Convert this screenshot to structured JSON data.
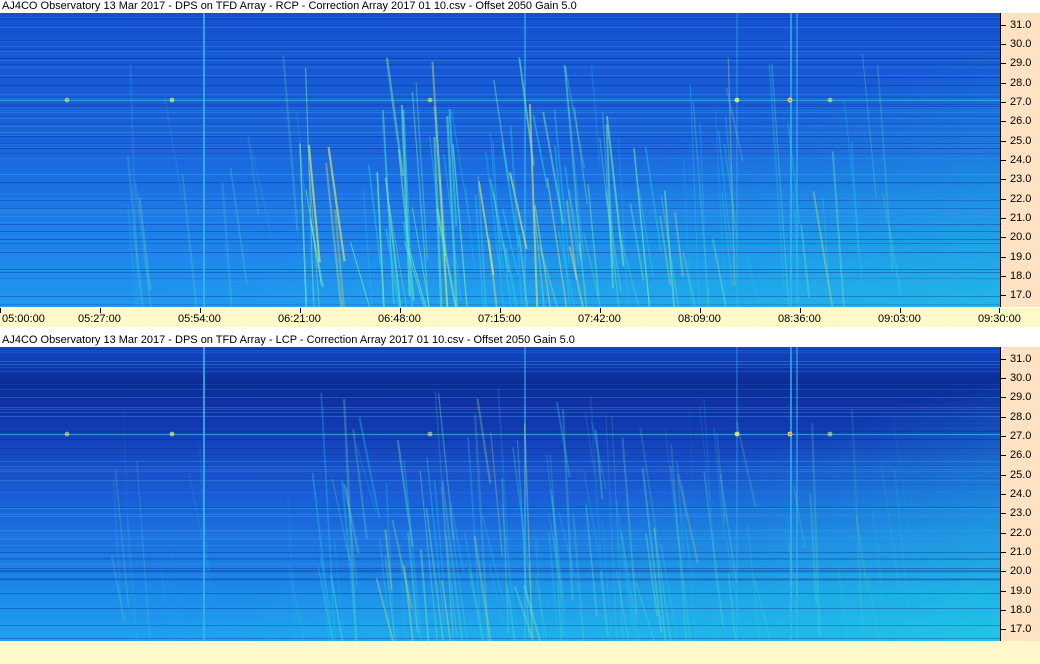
{
  "chart_data": [
    {
      "type": "heatmap",
      "title": "AJ4CO Observatory 13 Mar 2017  -  DPS on TFD Array  -  RCP  -  Correction Array 2017 01 10.csv  -  Offset 2050  Gain 5.0",
      "polarization": "RCP",
      "x_tick_labels": [
        "05:00:00",
        "05:27:00",
        "05:54:00",
        "06:21:00",
        "06:48:00",
        "07:15:00",
        "07:42:00",
        "08:09:00",
        "08:36:00",
        "09:03:00",
        "09:30:00"
      ],
      "y_tick_labels": [
        "31.0",
        "30.0",
        "29.0",
        "28.0",
        "27.0",
        "26.0",
        "25.0",
        "24.0",
        "23.0",
        "22.0",
        "21.0",
        "20.0",
        "19.0",
        "18.0",
        "17.0"
      ],
      "xlim": [
        "05:00:00",
        "09:30:00"
      ],
      "ylim": [
        16.4,
        31.6
      ],
      "colormap": [
        "#0a2a9a",
        "#1a5ad6",
        "#1f8ef0",
        "#22c8e8",
        "#7cf0b0",
        "#e8f060",
        "#ff8040"
      ]
    },
    {
      "type": "heatmap",
      "title": "AJ4CO Observatory 13 Mar 2017  -  DPS on TFD Array  -  LCP  -  Correction Array 2017 01 10.csv  -  Offset 2050  Gain 5.0",
      "polarization": "LCP",
      "y_tick_labels": [
        "31.0",
        "30.0",
        "29.0",
        "28.0",
        "27.0",
        "26.0",
        "25.0",
        "24.0",
        "23.0",
        "22.0",
        "21.0",
        "20.0",
        "19.0",
        "18.0",
        "17.0"
      ],
      "xlim": [
        "05:00:00",
        "09:30:00"
      ],
      "ylim": [
        16.4,
        31.6
      ],
      "colormap": [
        "#0a2a9a",
        "#1a5ad6",
        "#1f8ef0",
        "#22c8e8",
        "#7cf0b0",
        "#e8f060",
        "#ff8040"
      ]
    }
  ]
}
